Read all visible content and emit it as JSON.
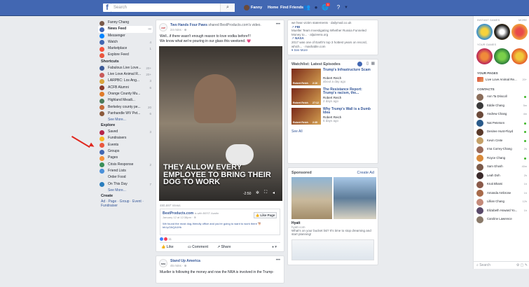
{
  "topbar": {
    "search_placeholder": "Search",
    "user_name": "Fanny",
    "home": "Home",
    "find_friends": "Find Friends",
    "notifications_badge": "1"
  },
  "sidebar": {
    "profile": "Fanny Chang",
    "items": [
      {
        "label": "News Feed",
        "count": "•••",
        "color": "#4267b2"
      },
      {
        "label": "Messenger",
        "count": "",
        "color": "#0084ff"
      },
      {
        "label": "Watch",
        "count": "4",
        "color": "#4267b2"
      },
      {
        "label": "Marketplace",
        "count": "1",
        "color": "#f5533d"
      },
      {
        "label": "Explore Feed",
        "count": "",
        "color": "#e9573f"
      }
    ],
    "shortcuts_title": "Shortcuts",
    "shortcuts": [
      {
        "label": "Fabulous Live Love...",
        "count": "20+",
        "color": "#3b5998"
      },
      {
        "label": "Live Love Animal R...",
        "count": "20+",
        "color": "#c95a5a"
      },
      {
        "label": "LARPBC: Los Ang...",
        "count": "3",
        "color": "#d9a43c"
      },
      {
        "label": "ACFB Alumni",
        "count": "6",
        "color": "#8a3b2b"
      },
      {
        "label": "Orange County Mu...",
        "count": "",
        "color": "#e07b2a"
      },
      {
        "label": "Highland Meadi...",
        "count": "",
        "color": "#4a7a5a"
      },
      {
        "label": "Berkeley county pe...",
        "count": "20",
        "color": "#c46a3a"
      },
      {
        "label": "Panhandle WV Pet...",
        "count": "6",
        "color": "#8b5a3c"
      }
    ],
    "shortcuts_more": "See More...",
    "explore_title": "Explore",
    "explore": [
      {
        "label": "Saved",
        "count": "3",
        "color": "#b5244a"
      },
      {
        "label": "Fundraisers",
        "count": "",
        "color": "#f7b928"
      },
      {
        "label": "Events",
        "count": "",
        "color": "#e9573f"
      },
      {
        "label": "Groups",
        "count": "",
        "color": "#4267b2"
      },
      {
        "label": "Pages",
        "count": "",
        "color": "#f7923a"
      },
      {
        "label": "Crisis Response",
        "count": "2",
        "color": "#3a8f5a"
      },
      {
        "label": "Friend Lists",
        "count": "",
        "color": "#4a90d9"
      },
      {
        "label": "Order Food",
        "count": "",
        "color": "#e8e8e8"
      },
      {
        "label": "On This Day",
        "count": "7",
        "color": "#2a7dbd"
      }
    ],
    "explore_more": "See More...",
    "create_title": "Create",
    "create_links": "Ad · Page · Group · Event · Fundraiser"
  },
  "post": {
    "author": "Two Hands Four Paws",
    "shared": "shared BestProducts.com's video.",
    "meta": "24 mins · ⊕",
    "text1": "Well...if there wasn't enough reason to love vodka before!!!",
    "text2": "We know what we're pouring in our glass this weekend. 💗",
    "caption": "THEY ALLOW EVERY EMPLOYEE TO BRING THEIR DOG TO WORK",
    "time": "-2:50",
    "views": "480,697 Views",
    "link_name": "BestProducts.com",
    "link_with": "is with BEST Austin",
    "link_meta": "January 12 at 12:38pm · ⊕",
    "link_text": "We found the most dog-friendly office and you're going to want to work there 🐕 bit.ly/2AQA1Hk",
    "like_page": "Like Page",
    "reaction_count": "11",
    "like": "Like",
    "comment": "Comment",
    "share": "Share"
  },
  "post2": {
    "author": "Stand Up America",
    "meta": "45 mins · ⊕",
    "text": "Mueller is following the money and now the NRA is involved in the Trump-"
  },
  "trending": [
    {
      "icon": "",
      "title": "",
      "desc": "we hear victim statements · dailymail.co.uk"
    },
    {
      "icon": "↗",
      "title": "FBI",
      "desc": "Mueller Team Investigating Whether Russia Funneled Money to... · aljazeera.org"
    },
    {
      "icon": "↗",
      "title": "NASA",
      "desc": "2017 was one of Earth's top 3 hottest years on record, which... · mashable.com"
    }
  ],
  "trending_more": "See More",
  "watchlist": {
    "title": "Watchlist: Latest Episodes",
    "items": [
      {
        "title": "Trump's Infrastructure Scam",
        "author": "Robert Reich",
        "date": "about a day ago",
        "thumb": "Robert Reich",
        "dur": "2:10"
      },
      {
        "title": "The Resistance Report: Trump's racism, the...",
        "author": "Robert Reich",
        "date": "2 days ago",
        "thumb": "Robert Reich",
        "dur": "27:12"
      },
      {
        "title": "Why Trump's Wall is a Dumb Idea",
        "author": "Robert Reich",
        "date": "5 days ago",
        "thumb": "Robert Reich",
        "dur": "2:35"
      }
    ],
    "see_all": "See All"
  },
  "sponsored": {
    "title": "Sponsored",
    "create_ad": "Create Ad",
    "ad_title": "Hyatt",
    "ad_url": "hyatt.com",
    "ad_desc": "What's on your bucket list? It's time to stop dreaming and start planning!"
  },
  "chat": {
    "instant_games": "INSTANT GAMES",
    "more": "MORE",
    "your_games": "YOUR GAMES",
    "your_pages": "YOUR PAGES",
    "page_name": "Live Love Animal Re...",
    "page_count": "20+",
    "contacts_title": "CONTACTS",
    "contacts": [
      {
        "name": "Ann Ta Driscoll",
        "status": "online",
        "color": "#8a6d5a"
      },
      {
        "name": "Eddie Chang",
        "status": "5m",
        "color": "#3a3a3a"
      },
      {
        "name": "Andrew Chang",
        "status": "4m",
        "color": "#6b4a3a"
      },
      {
        "name": "Nat Petersen",
        "status": "online",
        "color": "#2a5a8a"
      },
      {
        "name": "Desiree Hunt-Floyd",
        "status": "online",
        "color": "#5a3a2a"
      },
      {
        "name": "Kevin Crete",
        "status": "online",
        "color": "#c4a068"
      },
      {
        "name": "Irna Correy-Chang",
        "status": "2h",
        "color": "#9a6a5a"
      },
      {
        "name": "Royce Chang",
        "status": "online",
        "color": "#d98a3a"
      },
      {
        "name": "Sam Ghosh",
        "status": "40m",
        "color": "#7a5a4a"
      },
      {
        "name": "Leah Doh",
        "status": "2h",
        "color": "#3a2a2a"
      },
      {
        "name": "Kruti Bhami",
        "status": "1h",
        "color": "#8a5a4a"
      },
      {
        "name": "Amanda Ambrose",
        "status": "1h",
        "color": "#a86a4a"
      },
      {
        "name": "Lillian Chang",
        "status": "12h",
        "color": "#c48a7a"
      },
      {
        "name": "Elizabeth Howard Yo...",
        "status": "1h",
        "color": "#5a4a6a"
      },
      {
        "name": "Caroline Lawrence",
        "status": "",
        "color": "#8a7a6a"
      }
    ],
    "search": "Search"
  }
}
